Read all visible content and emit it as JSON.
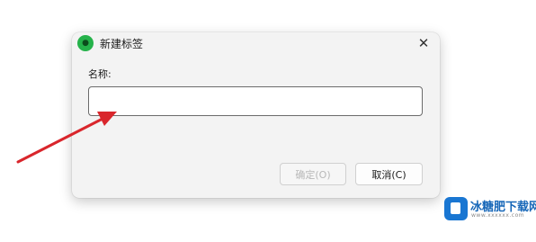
{
  "dialog": {
    "title": "新建标签",
    "close_glyph": "✕",
    "name_label": "名称:",
    "name_value": "",
    "ok_label": "确定(O)",
    "cancel_label": "取消(C)"
  },
  "icons": {
    "app": "app-logo-icon",
    "close": "close-icon",
    "arrow": "red-arrow-annotation"
  },
  "watermark": {
    "text": "冰糖肥下载网",
    "url": "www.xxxxxx.com"
  },
  "colors": {
    "dialog_bg": "#f3f3f3",
    "arrow": "#d9262c",
    "watermark": "#1767b8"
  }
}
